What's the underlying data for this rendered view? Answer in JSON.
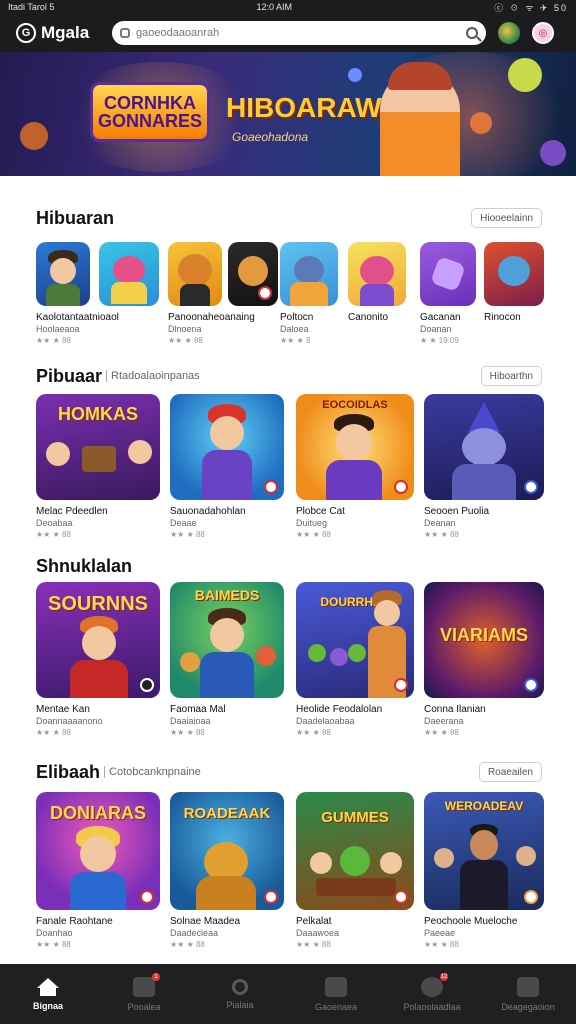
{
  "status_bar": {
    "left": "Itadi Tarol 5",
    "time": "12:0 AIM",
    "right": "ⓒ ☉ ᯤ ✈ 50"
  },
  "app": {
    "name": "Mgala"
  },
  "search": {
    "placeholder": "gaoeodaaoanrah"
  },
  "hero": {
    "badge": "CORNHKA GONNARES",
    "title": "HIBOARAWIS",
    "subtitle": "Goaeohadona"
  },
  "sections": [
    {
      "title": "Hibuaran",
      "subtitle": "",
      "button": "Hiooeelainn",
      "items": [
        {
          "name": "Kaolotantaatnioaol",
          "category": "Hoolaeaoa",
          "rating": "★★ ★ 88"
        },
        {
          "name": "",
          "category": "",
          "rating": ""
        },
        {
          "name": "Panoonaheoanaing",
          "category": "Dlnoena",
          "rating": "★★ ★ 88"
        },
        {
          "name": "",
          "category": "",
          "rating": ""
        },
        {
          "name": "Poltocn",
          "category": "Daloea",
          "rating": "★★ ★ 8"
        },
        {
          "name": "Canonito",
          "category": "",
          "rating": ""
        },
        {
          "name": "Gacanan",
          "category": "Doanan",
          "rating": "★ ★ 19.09"
        },
        {
          "name": "Rinocon",
          "category": "",
          "rating": ""
        }
      ]
    },
    {
      "title": "Pibuaar",
      "subtitle": "Rtadoalaoinpanas",
      "button": "Hiboarthn",
      "items": [
        {
          "name": "Melac Pdeedlen",
          "category": "Deoabaa",
          "rating": "★★ ★ 88",
          "sign": "HOMKAS"
        },
        {
          "name": "Sauonadahohlan",
          "category": "Deaae",
          "rating": "★★ ★ 88",
          "sign": ""
        },
        {
          "name": "Plobce Cat",
          "category": "Duitueg",
          "rating": "★★ ★ 88",
          "sign": "EOCOIDLAS"
        },
        {
          "name": "Seooen Puolia",
          "category": "Deanan",
          "rating": "★★ ★ 88",
          "sign": ""
        }
      ]
    },
    {
      "title": "Shnuklalan",
      "subtitle": "",
      "button": "",
      "items": [
        {
          "name": "Mentae Kan",
          "category": "Doannaaaanono",
          "rating": "★★ ★ 88",
          "sign": "SOURNNS"
        },
        {
          "name": "Faomaa Mal",
          "category": "Daaiaioaa",
          "rating": "★★ ★ 88",
          "sign": "BAIMEDS"
        },
        {
          "name": "Heolide Feodalolan",
          "category": "Daadelaoabaa",
          "rating": "★★ ★ 88",
          "sign": "DOURRHNS"
        },
        {
          "name": "Conna Ilanian",
          "category": "Daeerana",
          "rating": "★★ ★ 88",
          "sign": "VIARIAMS"
        }
      ]
    },
    {
      "title": "Elibaah",
      "subtitle": "Cotobcanknpnaine",
      "button": "Roaeailen",
      "items": [
        {
          "name": "Fanale Raohtane",
          "category": "Doanhao",
          "rating": "★★ ★ 88",
          "sign": "DONIARAS"
        },
        {
          "name": "Solnae Maadea",
          "category": "Daadecieaa",
          "rating": "★★ ★ 88",
          "sign": "ROADEAAK"
        },
        {
          "name": "Pelkalat",
          "category": "Daaawoea",
          "rating": "★★ ★ 88",
          "sign": "GUMMES"
        },
        {
          "name": "Peochoole Mueloche",
          "category": "Paeeae",
          "rating": "★★ ★ 88",
          "sign": "WEROADEAV"
        }
      ]
    }
  ],
  "bottom_nav": [
    {
      "label": "Bignaa",
      "icon": "home-icon",
      "badge": ""
    },
    {
      "label": "Pooalea",
      "icon": "store-icon",
      "badge": "1"
    },
    {
      "label": "Pialaia",
      "icon": "search-icon",
      "badge": ""
    },
    {
      "label": "Gaoenaea",
      "icon": "bag-icon",
      "badge": ""
    },
    {
      "label": "Polaoolaadlaa",
      "icon": "profile-icon",
      "badge": "12"
    },
    {
      "label": "Deagegaoion",
      "icon": "library-icon",
      "badge": ""
    }
  ]
}
